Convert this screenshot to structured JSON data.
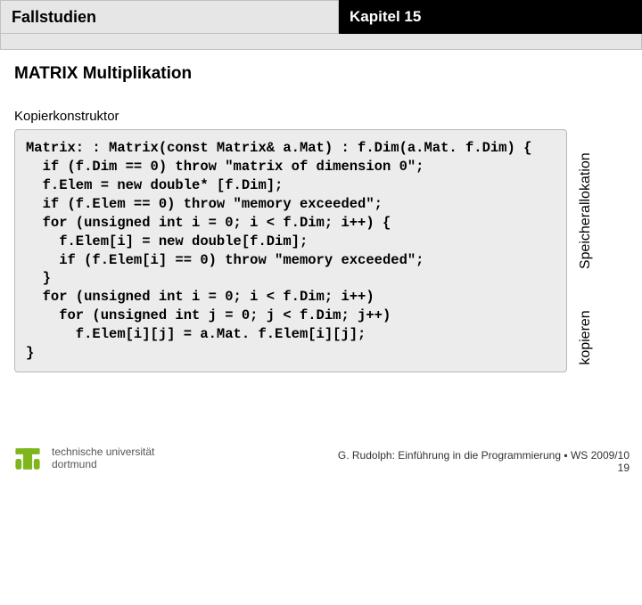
{
  "header": {
    "left": "Fallstudien",
    "right": "Kapitel 15"
  },
  "section_title": "MATRIX Multiplikation",
  "sub_title": "Kopierkonstruktor",
  "code": "Matrix: : Matrix(const Matrix& a.Mat) : f.Dim(a.Mat. f.Dim) {\n  if (f.Dim == 0) throw \"matrix of dimension 0\";\n  f.Elem = new double* [f.Dim];\n  if (f.Elem == 0) throw \"memory exceeded\";\n  for (unsigned int i = 0; i < f.Dim; i++) {\n    f.Elem[i] = new double[f.Dim];\n    if (f.Elem[i] == 0) throw \"memory exceeded\";\n  }\n  for (unsigned int i = 0; i < f.Dim; i++)\n    for (unsigned int j = 0; j < f.Dim; j++)\n      f.Elem[i][j] = a.Mat. f.Elem[i][j];\n}",
  "side_labels": {
    "top": "Speicherallokation",
    "bottom": "kopieren"
  },
  "footer": {
    "uni_line1": "technische universität",
    "uni_line2": "dortmund",
    "credit": "G. Rudolph: Einführung in die Programmierung ▪ WS 2009/10",
    "page": "19"
  },
  "colors": {
    "accent": "#7fb51d"
  }
}
